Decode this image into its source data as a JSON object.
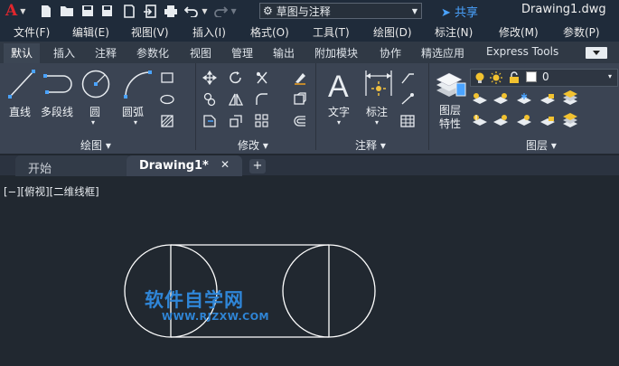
{
  "app": {
    "logo": "A",
    "workspace": "草图与注释",
    "share": "共享",
    "document_title": "Drawing1.dwg"
  },
  "menu": [
    "文件(F)",
    "编辑(E)",
    "视图(V)",
    "插入(I)",
    "格式(O)",
    "工具(T)",
    "绘图(D)",
    "标注(N)",
    "修改(M)",
    "参数(P)"
  ],
  "ribbon_tabs": [
    "默认",
    "插入",
    "注释",
    "参数化",
    "视图",
    "管理",
    "输出",
    "附加模块",
    "协作",
    "精选应用",
    "Express Tools"
  ],
  "draw_panel": {
    "title": "绘图",
    "tools": [
      "直线",
      "多段线",
      "圆",
      "圆弧"
    ]
  },
  "modify_panel": {
    "title": "修改"
  },
  "annotate_panel": {
    "title": "注释",
    "tools": [
      "文字",
      "标注"
    ]
  },
  "layer_panel": {
    "title": "图层",
    "properties_label": "图层特性",
    "current_layer": "0"
  },
  "doc_tabs": {
    "start": "开始",
    "drawing": "Drawing1*"
  },
  "viewport_label": "[−][俯视][二维线框]",
  "watermark": {
    "main": "软件自学网",
    "url": "WWW.RJZXW.COM"
  },
  "colors": {
    "background": "#212830",
    "ribbon": "#3b4453",
    "accent_blue": "#4aa3ff",
    "logo_red": "#e0262d",
    "geometry": "#ffffff"
  }
}
